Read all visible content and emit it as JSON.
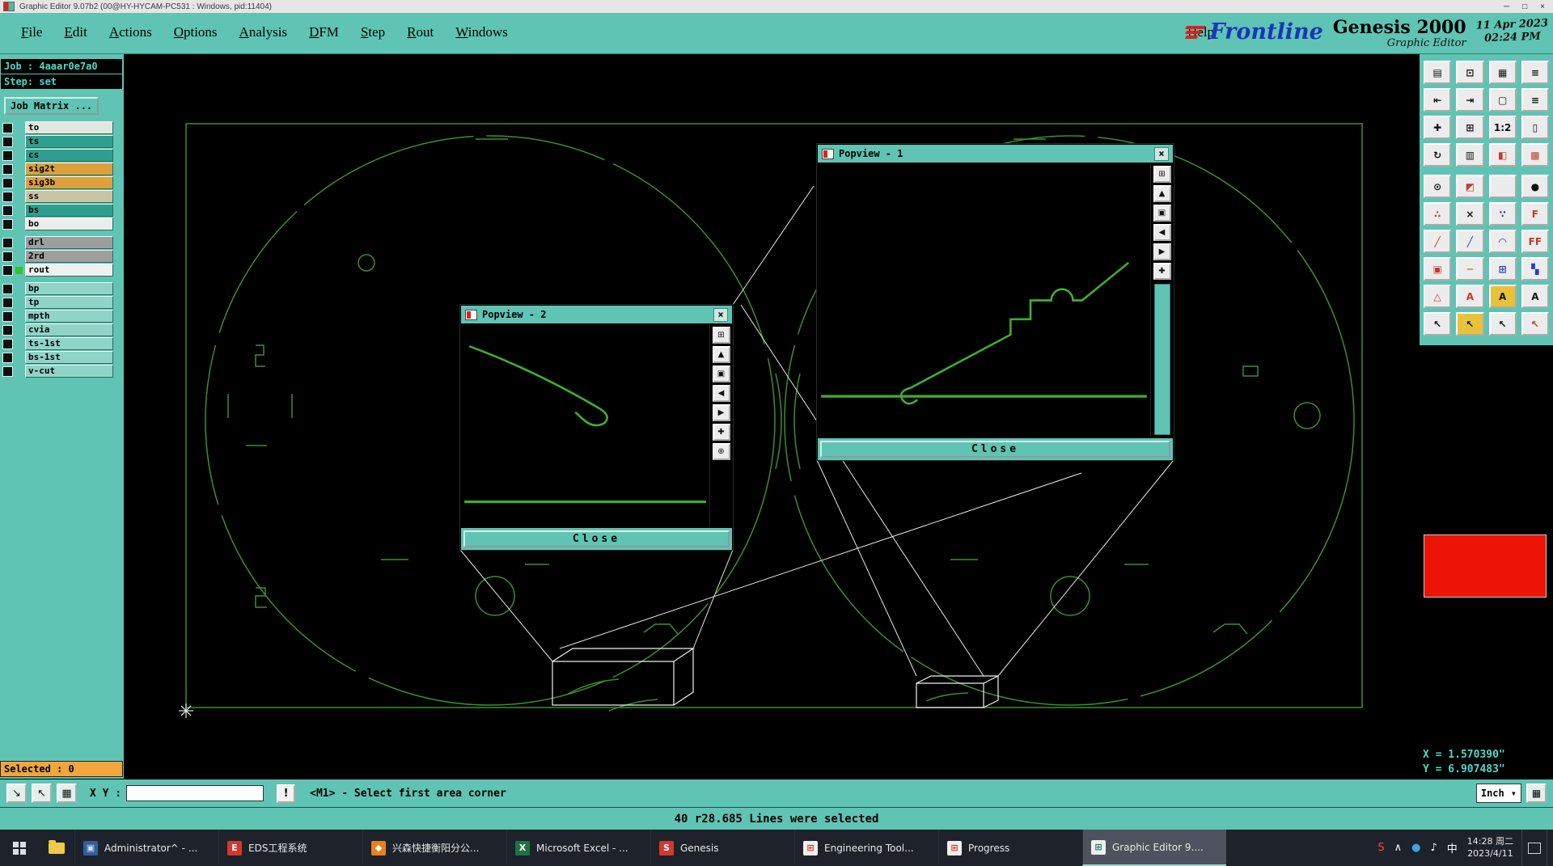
{
  "window": {
    "title": "Graphic Editor 9.07b2 (00@HY-HYCAM-PC531 : Windows, pid:11404)",
    "minimize": "─",
    "maximize": "□",
    "close": "×"
  },
  "menubar": {
    "items": [
      "File",
      "Edit",
      "Actions",
      "Options",
      "Analysis",
      "DFM",
      "Step",
      "Rout",
      "Windows"
    ],
    "help": "Help"
  },
  "branding": {
    "logo": "Frontline",
    "product": "Genesis 2000",
    "subtitle": "Graphic Editor",
    "date": "11 Apr 2023",
    "time": "02:24 PM"
  },
  "sidebar": {
    "job": "Job : 4aaar0e7a0",
    "step": "Step: set",
    "job_matrix": "Job Matrix ...",
    "board_layers": [
      {
        "name": "to",
        "bg": "#e2e8de"
      },
      {
        "name": "ts",
        "bg": "#2f9e8e"
      },
      {
        "name": "cs",
        "bg": "#2f9e8e"
      },
      {
        "name": "sig2t",
        "bg": "#dfa03c"
      },
      {
        "name": "sig3b",
        "bg": "#dfa03c"
      },
      {
        "name": "ss",
        "bg": "#c6c6a4"
      },
      {
        "name": "bs",
        "bg": "#2f9e8e"
      },
      {
        "name": "bo",
        "bg": "#ececec"
      }
    ],
    "drill_layers": [
      {
        "name": "drl",
        "bg": "#9e9e9e"
      },
      {
        "name": "2rd",
        "bg": "#9e9e9e"
      },
      {
        "name": "rout",
        "bg": "#f0f0f0",
        "marker": "#2fc42f"
      }
    ],
    "misc_layers": [
      {
        "name": "bp",
        "bg": "#90d4c8"
      },
      {
        "name": "tp",
        "bg": "#90d4c8"
      },
      {
        "name": "mpth",
        "bg": "#90d4c8"
      },
      {
        "name": "cvia",
        "bg": "#90d4c8"
      },
      {
        "name": "ts-1st",
        "bg": "#90d4c8"
      },
      {
        "name": "bs-1st",
        "bg": "#90d4c8"
      },
      {
        "name": "v-cut",
        "bg": "#90d4c8"
      }
    ],
    "selected": "Selected : 0"
  },
  "popview1": {
    "title": "Popview - 1",
    "close_x": "×",
    "close": "Close",
    "icons": [
      {
        "n": "detach-window-icon",
        "g": "⊞"
      },
      {
        "n": "zoom-up-icon",
        "g": "▲"
      },
      {
        "n": "full-screen-icon",
        "g": "▣"
      },
      {
        "n": "pan-left-icon",
        "g": "◀"
      },
      {
        "n": "pan-right-icon",
        "g": "▶"
      },
      {
        "n": "center-view-icon",
        "g": "✚"
      }
    ]
  },
  "popview2": {
    "title": "Popview - 2",
    "close_x": "×",
    "close": "Close",
    "icons": [
      {
        "n": "detach-window-icon",
        "g": "⊞"
      },
      {
        "n": "zoom-up-icon",
        "g": "▲"
      },
      {
        "n": "full-screen-icon",
        "g": "▣"
      },
      {
        "n": "pan-left-icon",
        "g": "◀"
      },
      {
        "n": "pan-right-icon",
        "g": "▶"
      },
      {
        "n": "center-view-icon",
        "g": "✚"
      },
      {
        "n": "expand-view-icon",
        "g": "⊕"
      }
    ]
  },
  "right_panel": {
    "icons_top": [
      {
        "n": "job-matrix-icon",
        "g": "▤"
      },
      {
        "n": "screen-layout-icon",
        "g": "⊡"
      },
      {
        "n": "panel-grid-icon",
        "g": "▦"
      },
      {
        "n": "list-view-icon",
        "g": "≡"
      },
      {
        "n": "shift-left-icon",
        "g": "⇤"
      },
      {
        "n": "shift-right-icon",
        "g": "⇥"
      },
      {
        "n": "tile-windows-icon",
        "g": "▢"
      },
      {
        "n": "stack-rows-icon",
        "g": "≡"
      },
      {
        "n": "zoom-home-icon",
        "g": "✚"
      },
      {
        "n": "zoom-window-icon",
        "g": "⊞"
      },
      {
        "n": "zoom-ratio-icon",
        "g": "1:2"
      },
      {
        "n": "page-view-icon",
        "g": "▯"
      },
      {
        "n": "redraw-icon",
        "g": "↻"
      },
      {
        "n": "grid-table-icon",
        "g": "▥"
      },
      {
        "n": "split-view-icon",
        "g": "◧",
        "c": "#c23b2e"
      },
      {
        "n": "highlight-grid-icon",
        "g": "▩",
        "c": "#c23b2e"
      }
    ],
    "icons_main": [
      {
        "n": "pen-circle-icon",
        "g": "⊙"
      },
      {
        "n": "mask-corner-icon",
        "g": "◩",
        "c": "#c23b2e"
      },
      {
        "n": "blank-button",
        "g": " "
      },
      {
        "n": "filled-circle-icon",
        "g": "●"
      },
      {
        "n": "net-points-icon",
        "g": "∴",
        "c": "#c23b2e"
      },
      {
        "n": "delete-cross-icon",
        "g": "×"
      },
      {
        "n": "dots-icon",
        "g": "∵",
        "c": "#2a3bc2"
      },
      {
        "n": "letter-f-icon",
        "g": "F",
        "c": "#c23b2e"
      },
      {
        "n": "red-line-icon",
        "g": "╱",
        "c": "#c23b2e"
      },
      {
        "n": "blue-line-icon",
        "g": "╱",
        "c": "#2a3bc2"
      },
      {
        "n": "arc-icon",
        "g": "◠",
        "c": "#2a3bc2"
      },
      {
        "n": "letters-ff-icon",
        "g": "FF",
        "c": "#c23b2e"
      },
      {
        "n": "red-pad-icon",
        "g": "▣",
        "c": "#c23b2e"
      },
      {
        "n": "red-trace-icon",
        "g": "─",
        "c": "#c23b2e"
      },
      {
        "n": "crosshair-box-icon",
        "g": "⊞",
        "c": "#2a3bc2"
      },
      {
        "n": "halftone-icon",
        "g": "▚",
        "c": "#2a3bc2"
      },
      {
        "n": "red-triangle-icon",
        "g": "△",
        "c": "#c23b2e"
      },
      {
        "n": "letter-a-red-icon",
        "g": "A",
        "c": "#c23b2e"
      },
      {
        "n": "letter-a-yellow-icon",
        "g": "A",
        "b": "#e8c23a"
      },
      {
        "n": "letter-a-plain-icon",
        "g": "A"
      },
      {
        "n": "select-arrow-icon",
        "g": "↖"
      },
      {
        "n": "select-arrow-yellow-icon",
        "g": "↖",
        "b": "#e8c23a"
      },
      {
        "n": "select-arrow-bold-icon",
        "g": "↖"
      },
      {
        "n": "select-arrow-red-icon",
        "g": "↖",
        "c": "#c23b2e"
      }
    ],
    "coord_x": "X = 1.570390\"",
    "coord_y": "Y = 6.907483\""
  },
  "xybar": {
    "snap_icons": [
      {
        "n": "diagonal-snap-icon",
        "g": "↘"
      },
      {
        "n": "pointer-snap-icon",
        "g": "↖"
      },
      {
        "n": "grid-snap-icon",
        "g": "▦"
      }
    ],
    "label": "X Y :",
    "input_value": "",
    "bang": "!",
    "prompt": "<M1> - Select first area corner",
    "unit": "Inch",
    "unit_arrow": "▾",
    "keypad": "▦"
  },
  "status_message": "40 r28.685 Lines were selected",
  "taskbar": {
    "items": [
      {
        "label": "Administrator^ - ...",
        "g": "▣",
        "c": "#cfe3f5",
        "b": "#2f5f9e",
        "active": "false"
      },
      {
        "label": "EDS工程系统",
        "g": "E",
        "c": "#ffffff",
        "b": "#d03a2e",
        "active": "false"
      },
      {
        "label": "兴森快捷衡阳分公...",
        "g": "◆",
        "c": "#ffffff",
        "b": "#e8821e",
        "active": "false"
      },
      {
        "label": "Microsoft Excel - ...",
        "g": "X",
        "c": "#ffffff",
        "b": "#1e7145",
        "active": "false"
      },
      {
        "label": "Genesis",
        "g": "S",
        "c": "#ffffff",
        "b": "#d03a2e",
        "active": "false"
      },
      {
        "label": "Engineering Tool...",
        "g": "⊞",
        "c": "#d03a2e",
        "b": "#f0f0f0",
        "active": "false"
      },
      {
        "label": "Progress",
        "g": "⊞",
        "c": "#d03a2e",
        "b": "#f0f0f0",
        "active": "false"
      },
      {
        "label": "Graphic Editor 9....",
        "g": "⊞",
        "c": "#0a7a6a",
        "b": "#f0f0f0",
        "active": "true"
      }
    ],
    "tray": [
      {
        "n": "sogou-icon",
        "g": "S",
        "c": "#ff4633"
      },
      {
        "n": "hidden-icons-chevron",
        "g": "∧",
        "c": "#ffffff"
      },
      {
        "n": "network-icon",
        "g": "●",
        "c": "#3aa3e8"
      },
      {
        "n": "volume-icon",
        "g": "♪",
        "c": "#ffffff"
      },
      {
        "n": "ime-icon",
        "g": "中",
        "c": "#ffffff"
      }
    ],
    "clock": {
      "time": "14:28 周二",
      "date": "2023/4/11"
    }
  }
}
